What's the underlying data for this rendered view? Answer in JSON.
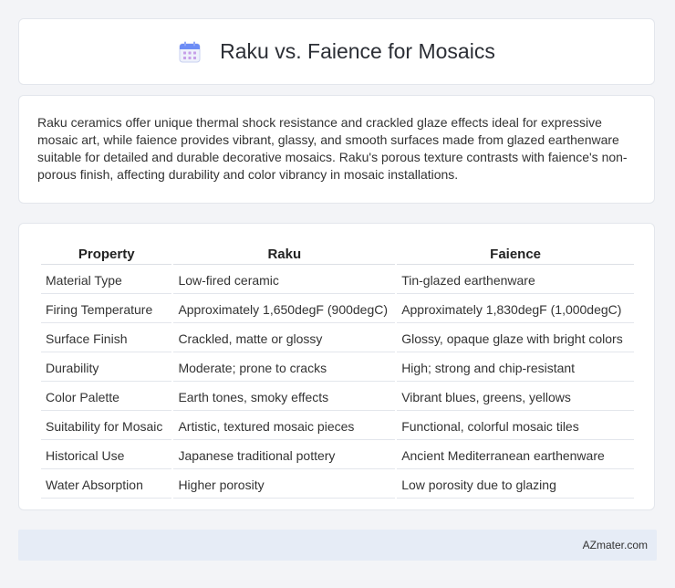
{
  "header": {
    "title": "Raku vs. Faience for Mosaics",
    "icon": "calendar-icon"
  },
  "description": "Raku ceramics offer unique thermal shock resistance and crackled glaze effects ideal for expressive mosaic art, while faience provides vibrant, glassy, and smooth surfaces made from glazed earthenware suitable for detailed and durable decorative mosaics. Raku's porous texture contrasts with faience's non-porous finish, affecting durability and color vibrancy in mosaic installations.",
  "table": {
    "headers": [
      "Property",
      "Raku",
      "Faience"
    ],
    "rows": [
      [
        "Material Type",
        "Low-fired ceramic",
        "Tin-glazed earthenware"
      ],
      [
        "Firing Temperature",
        "Approximately 1,650degF (900degC)",
        "Approximately 1,830degF (1,000degC)"
      ],
      [
        "Surface Finish",
        "Crackled, matte or glossy",
        "Glossy, opaque glaze with bright colors"
      ],
      [
        "Durability",
        "Moderate; prone to cracks",
        "High; strong and chip-resistant"
      ],
      [
        "Color Palette",
        "Earth tones, smoky effects",
        "Vibrant blues, greens, yellows"
      ],
      [
        "Suitability for Mosaic",
        "Artistic, textured mosaic pieces",
        "Functional, colorful mosaic tiles"
      ],
      [
        "Historical Use",
        "Japanese traditional pottery",
        "Ancient Mediterranean earthenware"
      ],
      [
        "Water Absorption",
        "Higher porosity",
        "Low porosity due to glazing"
      ]
    ]
  },
  "footer": {
    "brand": "AZmater.com"
  },
  "colors": {
    "background": "#f3f4f7",
    "card": "#ffffff",
    "footer": "#e6ecf6",
    "icon_accent": "#6c8cf5"
  }
}
